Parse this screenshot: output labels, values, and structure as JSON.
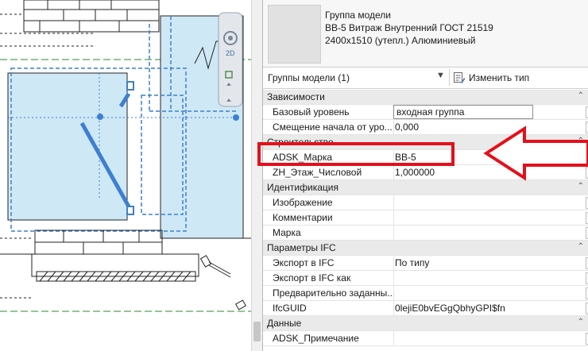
{
  "type_selector": {
    "lines": [
      "Группа модели",
      "ВВ-5  Витраж Внутренний ГОСТ 21519",
      "2400x1510 (утепл.) Алюминиевый"
    ]
  },
  "instance_selector": {
    "label": "Группы модели (1)",
    "edit_type_label": "Изменить тип"
  },
  "properties": [
    {
      "kind": "group",
      "name": "Зависимости"
    },
    {
      "kind": "edit",
      "name": "Базовый уровень",
      "value": "входная группа"
    },
    {
      "kind": "param",
      "name": "Смещение начала от уро...",
      "value": "0,000"
    },
    {
      "kind": "group",
      "name": "Строительство"
    },
    {
      "kind": "param",
      "name": "ADSK_Марка",
      "value": "ВВ-5"
    },
    {
      "kind": "param",
      "name": "ZH_Этаж_Числовой",
      "value": "1,000000"
    },
    {
      "kind": "group",
      "name": "Идентификация"
    },
    {
      "kind": "param",
      "name": "Изображение",
      "value": ""
    },
    {
      "kind": "param",
      "name": "Комментарии",
      "value": ""
    },
    {
      "kind": "param",
      "name": "Марка",
      "value": ""
    },
    {
      "kind": "group",
      "name": "Параметры IFC"
    },
    {
      "kind": "param",
      "name": "Экспорт в IFC",
      "value": "По типу"
    },
    {
      "kind": "param",
      "name": "Экспорт в IFC как",
      "value": ""
    },
    {
      "kind": "param",
      "name": "Предварительно заданны...",
      "value": ""
    },
    {
      "kind": "param",
      "name": "IfcGUID",
      "value": "0lejiE0bvEGgQbhyGPI$fn"
    },
    {
      "kind": "group",
      "name": "Данные"
    },
    {
      "kind": "param",
      "name": "ADSK_Примечание",
      "value": ""
    }
  ],
  "nav_bar": {
    "view_mode": "2D"
  },
  "colors": {
    "highlight_red": "#e3101b",
    "selection_blue": "#3d7fd1",
    "selection_fill": "#cfe8f5",
    "level_green": "#2e8b2e"
  }
}
